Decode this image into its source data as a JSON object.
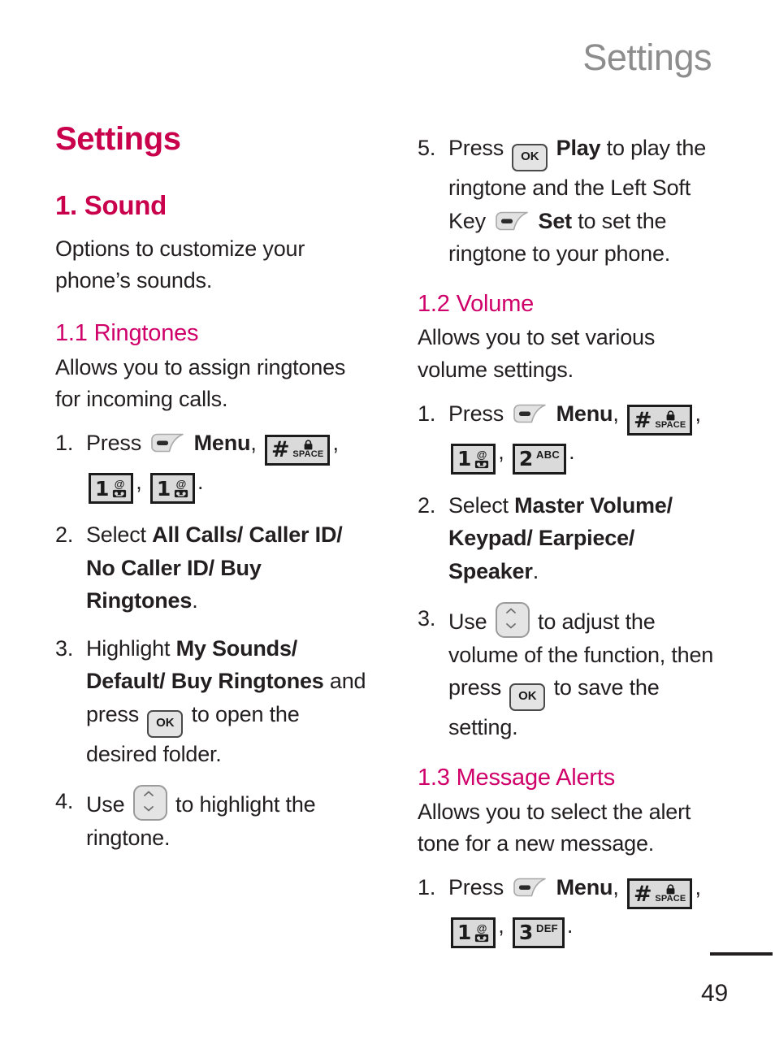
{
  "header": {
    "running_title": "Settings"
  },
  "colors": {
    "heading_primary": "#c9004c",
    "heading_secondary": "#d0006a",
    "running_header": "#8d8d8d",
    "body_text": "#231f20"
  },
  "left_column": {
    "title": "Settings",
    "section_heading": "1. Sound",
    "section_intro": "Options to customize your phone’s sounds.",
    "subsection": {
      "heading": "1.1 Ringtones",
      "intro": "Allows you to assign ringtones for incoming calls.",
      "steps": [
        {
          "num": "1.",
          "parts": [
            {
              "type": "text",
              "value": "Press "
            },
            {
              "type": "icon",
              "value": "left-soft-key"
            },
            {
              "type": "bold",
              "value": " Menu"
            },
            {
              "type": "text",
              "value": ", "
            },
            {
              "type": "icon",
              "value": "hash-space-key"
            },
            {
              "type": "text",
              "value": ", "
            },
            {
              "type": "icon",
              "value": "key-1"
            },
            {
              "type": "text",
              "value": ", "
            },
            {
              "type": "icon",
              "value": "key-1"
            },
            {
              "type": "text",
              "value": "."
            }
          ]
        },
        {
          "num": "2.",
          "parts": [
            {
              "type": "text",
              "value": "Select "
            },
            {
              "type": "bold",
              "value": "All Calls/ Caller ID/ No Caller ID/ Buy Ringtones"
            },
            {
              "type": "text",
              "value": "."
            }
          ]
        },
        {
          "num": "3.",
          "parts": [
            {
              "type": "text",
              "value": "Highlight "
            },
            {
              "type": "bold",
              "value": "My Sounds/ Default/ Buy Ringtones"
            },
            {
              "type": "text",
              "value": " and press "
            },
            {
              "type": "icon",
              "value": "ok-key"
            },
            {
              "type": "text",
              "value": " to open the desired folder."
            }
          ]
        },
        {
          "num": "4.",
          "parts": [
            {
              "type": "text",
              "value": "Use "
            },
            {
              "type": "icon",
              "value": "navigation-key"
            },
            {
              "type": "text",
              "value": " to highlight the ringtone."
            }
          ]
        }
      ]
    }
  },
  "right_column": {
    "continued_step": {
      "num": "5.",
      "parts": [
        {
          "type": "text",
          "value": "Press "
        },
        {
          "type": "icon",
          "value": "ok-key"
        },
        {
          "type": "bold",
          "value": " Play"
        },
        {
          "type": "text",
          "value": " to play the ringtone and the Left Soft Key "
        },
        {
          "type": "icon",
          "value": "left-soft-key"
        },
        {
          "type": "bold",
          "value": " Set"
        },
        {
          "type": "text",
          "value": " to set the ringtone to your phone."
        }
      ]
    },
    "subsections": [
      {
        "heading": "1.2 Volume",
        "intro": "Allows you to set various volume settings.",
        "steps": [
          {
            "num": "1.",
            "parts": [
              {
                "type": "text",
                "value": "Press "
              },
              {
                "type": "icon",
                "value": "left-soft-key"
              },
              {
                "type": "bold",
                "value": " Menu"
              },
              {
                "type": "text",
                "value": ", "
              },
              {
                "type": "icon",
                "value": "hash-space-key"
              },
              {
                "type": "text",
                "value": ", "
              },
              {
                "type": "icon",
                "value": "key-1"
              },
              {
                "type": "text",
                "value": ", "
              },
              {
                "type": "icon",
                "value": "key-2-abc"
              },
              {
                "type": "text",
                "value": "."
              }
            ]
          },
          {
            "num": "2.",
            "parts": [
              {
                "type": "text",
                "value": "Select "
              },
              {
                "type": "bold",
                "value": "Master Volume/ Keypad/ Earpiece/ Speaker"
              },
              {
                "type": "text",
                "value": "."
              }
            ]
          },
          {
            "num": "3.",
            "parts": [
              {
                "type": "text",
                "value": "Use "
              },
              {
                "type": "icon",
                "value": "navigation-key"
              },
              {
                "type": "text",
                "value": " to adjust the volume of the function, then press "
              },
              {
                "type": "icon",
                "value": "ok-key"
              },
              {
                "type": "text",
                "value": " to save the setting."
              }
            ]
          }
        ]
      },
      {
        "heading": "1.3 Message Alerts",
        "intro": "Allows you to select the alert tone for a new message.",
        "steps": [
          {
            "num": "1.",
            "parts": [
              {
                "type": "text",
                "value": "Press "
              },
              {
                "type": "icon",
                "value": "left-soft-key"
              },
              {
                "type": "bold",
                "value": " Menu"
              },
              {
                "type": "text",
                "value": ", "
              },
              {
                "type": "icon",
                "value": "hash-space-key"
              },
              {
                "type": "text",
                "value": ", "
              },
              {
                "type": "icon",
                "value": "key-1"
              },
              {
                "type": "text",
                "value": ", "
              },
              {
                "type": "icon",
                "value": "key-3-def"
              },
              {
                "type": "text",
                "value": "."
              }
            ]
          }
        ]
      }
    ]
  },
  "key_labels": {
    "ok": "OK",
    "hash": "#",
    "space": "SPACE",
    "one": "1",
    "two": "2",
    "three": "3",
    "abc": "ABC",
    "def": "DEF",
    "at": "@"
  },
  "footer": {
    "page_number": "49"
  }
}
